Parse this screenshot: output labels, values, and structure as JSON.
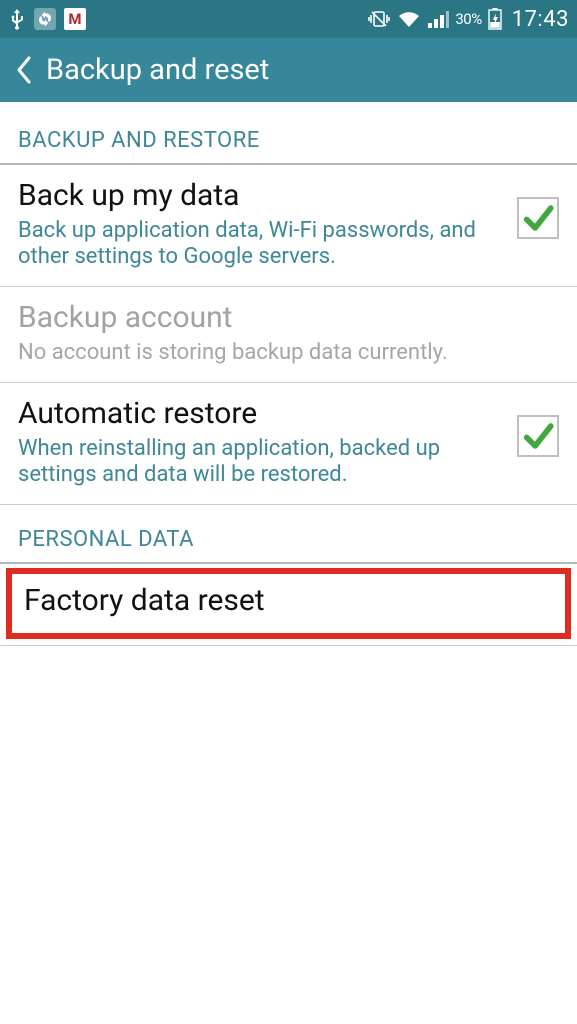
{
  "status_bar": {
    "battery_text": "30%",
    "clock": "17:43"
  },
  "title_bar": {
    "title": "Backup and reset"
  },
  "sections": {
    "backup_restore_header": "BACKUP AND RESTORE",
    "personal_data_header": "PERSONAL DATA"
  },
  "items": {
    "backup_my_data": {
      "title": "Back up my data",
      "sub": "Back up application data, Wi-Fi passwords, and other settings to Google servers."
    },
    "backup_account": {
      "title": "Backup account",
      "sub": "No account is storing backup data currently."
    },
    "automatic_restore": {
      "title": "Automatic restore",
      "sub": "When reinstalling an application, backed up settings and data will be restored."
    },
    "factory_reset": {
      "title": "Factory data reset"
    }
  }
}
